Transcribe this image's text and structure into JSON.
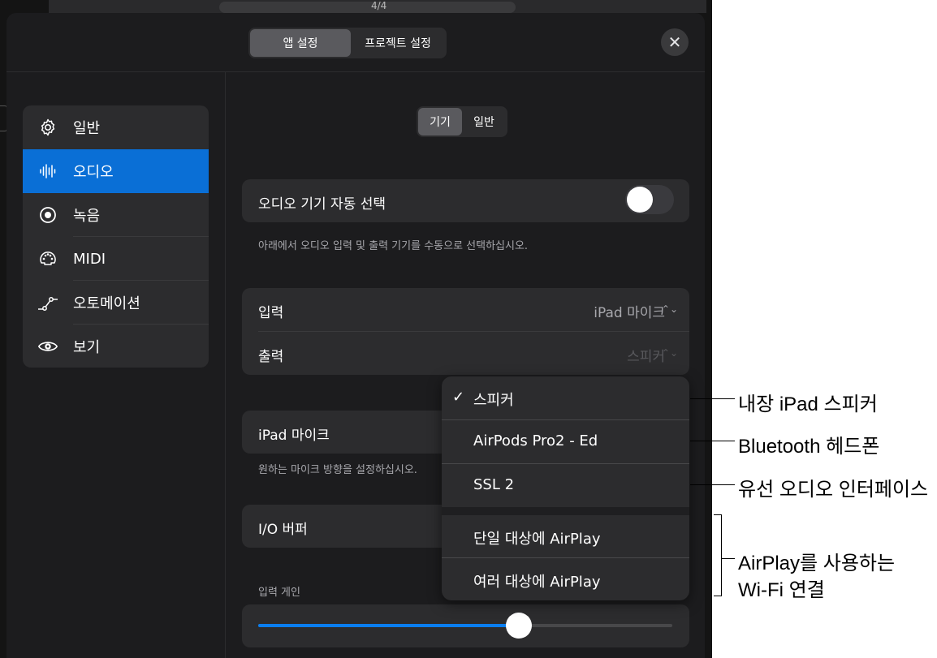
{
  "header": {
    "tabs": [
      {
        "label": "앱 설정",
        "selected": true
      },
      {
        "label": "프로젝트 설정",
        "selected": false
      }
    ],
    "close_icon": "close-icon"
  },
  "sidebar": {
    "items": [
      {
        "label": "일반",
        "icon": "gear-icon",
        "active": false
      },
      {
        "label": "오디오",
        "icon": "waveform-icon",
        "active": true
      },
      {
        "label": "녹음",
        "icon": "record-icon",
        "active": false
      },
      {
        "label": "MIDI",
        "icon": "midi-icon",
        "active": false
      },
      {
        "label": "오토메이션",
        "icon": "automation-icon",
        "active": false
      },
      {
        "label": "보기",
        "icon": "eye-icon",
        "active": false
      }
    ]
  },
  "subtabs": [
    {
      "label": "기기",
      "selected": true
    },
    {
      "label": "일반",
      "selected": false
    }
  ],
  "auto_select": {
    "label": "오디오 기기 자동 선택",
    "toggle_on": false,
    "note": "아래에서 오디오 입력 및 출력 기기를 수동으로 선택하십시오."
  },
  "io": {
    "input_label": "입력",
    "input_value": "iPad 마이크",
    "output_label": "출력",
    "output_value": "스피커"
  },
  "mic": {
    "label": "iPad 마이크",
    "note": "원하는 마이크 방향을 설정하십시오."
  },
  "buffer": {
    "label": "I/O 버퍼"
  },
  "gain": {
    "label": "입력 게인",
    "level": 0.63
  },
  "output_menu": {
    "items": [
      {
        "label": "스피커",
        "checked": true
      },
      {
        "label": "AirPods Pro2 - Ed",
        "checked": false
      },
      {
        "label": "SSL 2",
        "checked": false
      },
      {
        "label": "단일 대상에 AirPlay",
        "checked": false
      },
      {
        "label": "여러 대상에 AirPlay",
        "checked": false
      }
    ],
    "check_glyph": "✓"
  },
  "callouts": {
    "speaker": "내장 iPad 스피커",
    "bluetooth": "Bluetooth 헤드폰",
    "wired": "유선 오디오 인터페이스",
    "airplay_line1": "AirPlay를 사용하는",
    "airplay_line2": "Wi-Fi 연결"
  },
  "top_bar": {
    "meter_text": "4/4"
  },
  "colors": {
    "accent": "#0a6fd6",
    "slider": "#0a7ef0",
    "background": "#1c1c1e",
    "card": "#2c2c2e"
  }
}
